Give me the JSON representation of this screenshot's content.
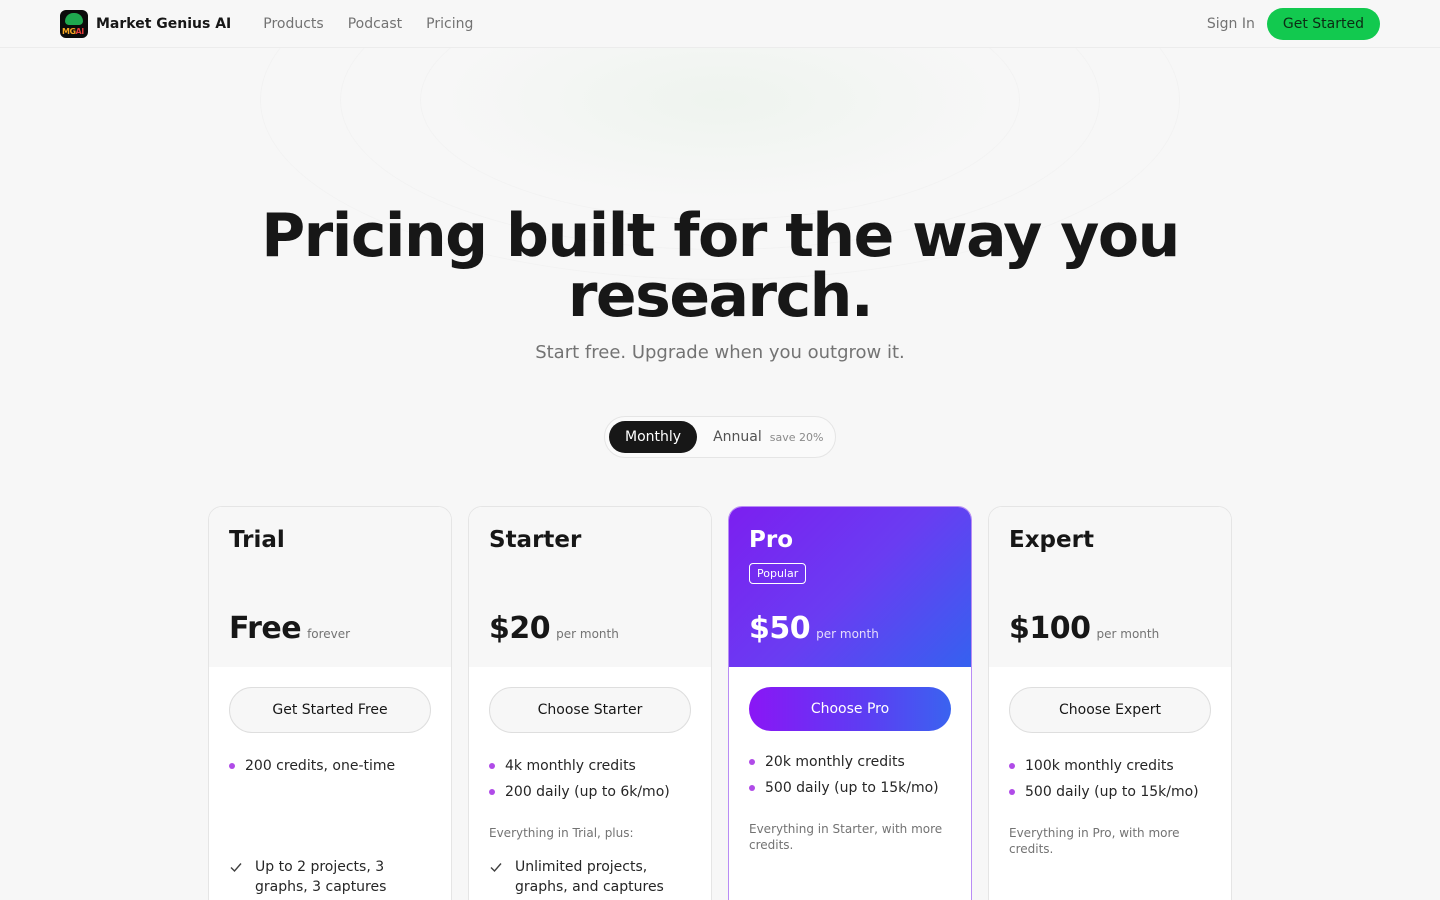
{
  "nav": {
    "brand": "Market Genius AI",
    "logo_text_a": "MG",
    "logo_text_b": "AI",
    "links": [
      "Products",
      "Podcast",
      "Pricing"
    ],
    "sign_in": "Sign In",
    "get_started": "Get Started"
  },
  "hero": {
    "title_line1": "Pricing built for the way you",
    "title_line2": "research.",
    "subtitle": "Start free. Upgrade when you outgrow it."
  },
  "billing_toggle": {
    "monthly": "Monthly",
    "annual": "Annual",
    "annual_note": "save 20%",
    "selected": "Monthly"
  },
  "plans": [
    {
      "name": "Trial",
      "price": "Free",
      "period": "forever",
      "cta": "Get Started Free",
      "credits": [
        "200 credits, one-time"
      ],
      "feature": "Up to 2 projects, 3 graphs, 3 captures"
    },
    {
      "name": "Starter",
      "price": "$20",
      "period": "per month",
      "cta": "Choose Starter",
      "credits": [
        "4k monthly credits",
        "200 daily (up to 6k/mo)"
      ],
      "inherits": "Everything in Trial, plus:",
      "feature": "Unlimited projects, graphs, and captures"
    },
    {
      "name": "Pro",
      "badge": "Popular",
      "price": "$50",
      "period": "per month",
      "cta": "Choose Pro",
      "credits": [
        "20k monthly credits",
        "500 daily (up to 15k/mo)"
      ],
      "inherits": "Everything in Starter, with more credits."
    },
    {
      "name": "Expert",
      "price": "$100",
      "period": "per month",
      "cta": "Choose Expert",
      "credits": [
        "100k monthly credits",
        "500 daily (up to 15k/mo)"
      ],
      "inherits": "Everything in Pro, with more credits."
    }
  ],
  "colors": {
    "accent_green": "#12c94f",
    "pro_gradient_start": "#7c1ff0",
    "pro_gradient_end": "#3561f0",
    "bullet": "#b04be8"
  }
}
